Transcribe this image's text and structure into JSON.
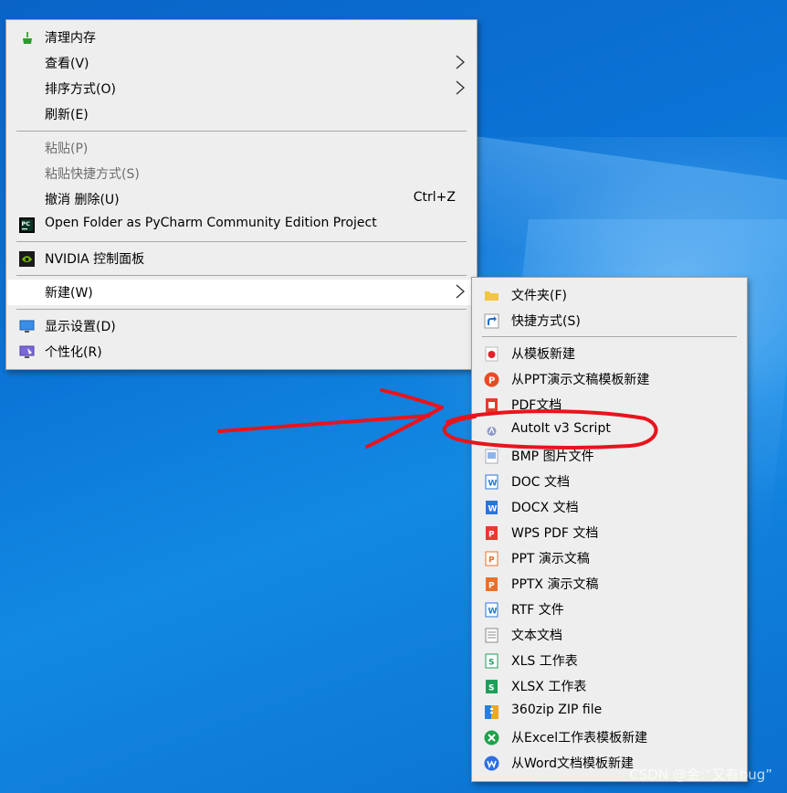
{
  "main_menu": {
    "items": [
      {
        "label": "清理内存"
      },
      {
        "label": "查看(V)"
      },
      {
        "label": "排序方式(O)"
      },
      {
        "label": "刷新(E)"
      },
      {
        "label": "粘贴(P)"
      },
      {
        "label": "粘贴快捷方式(S)"
      },
      {
        "label": "撤消 删除(U)",
        "shortcut": "Ctrl+Z"
      },
      {
        "label": "Open Folder as PyCharm Community Edition Project"
      },
      {
        "label": "NVIDIA 控制面板"
      },
      {
        "label": "新建(W)"
      },
      {
        "label": "显示设置(D)"
      },
      {
        "label": "个性化(R)"
      }
    ]
  },
  "sub_menu": {
    "items": [
      {
        "label": "文件夹(F)",
        "icon": "folder-icon"
      },
      {
        "label": "快捷方式(S)",
        "icon": "shortcut-icon"
      },
      {
        "label": "从模板新建",
        "icon": "template-icon"
      },
      {
        "label": "从PPT演示文稿模板新建",
        "icon": "ppt-template-icon"
      },
      {
        "label": "PDF文档",
        "icon": "pdf-icon"
      },
      {
        "label": "AutoIt v3 Script",
        "icon": "autoit-icon"
      },
      {
        "label": "BMP 图片文件",
        "icon": "bmp-icon"
      },
      {
        "label": "DOC 文档",
        "icon": "doc-icon"
      },
      {
        "label": "DOCX 文档",
        "icon": "docx-icon"
      },
      {
        "label": "WPS PDF 文档",
        "icon": "wps-pdf-icon"
      },
      {
        "label": "PPT 演示文稿",
        "icon": "ppt-icon"
      },
      {
        "label": "PPTX 演示文稿",
        "icon": "pptx-icon"
      },
      {
        "label": "RTF 文件",
        "icon": "rtf-icon"
      },
      {
        "label": "文本文档",
        "icon": "text-icon"
      },
      {
        "label": "XLS 工作表",
        "icon": "xls-icon"
      },
      {
        "label": "XLSX 工作表",
        "icon": "xlsx-icon"
      },
      {
        "label": "360zip ZIP file",
        "icon": "zip-icon"
      },
      {
        "label": "从Excel工作表模板新建",
        "icon": "excel-template-icon"
      },
      {
        "label": "从Word文档模板新建",
        "icon": "word-template-icon"
      }
    ]
  },
  "watermark": "CSDN @金:“又有bug”",
  "colors": {
    "menu_bg": "#eeeeee",
    "hover_bg": "#ffffff",
    "annotation": "#e8141c",
    "desktop": "#0b74d6"
  }
}
